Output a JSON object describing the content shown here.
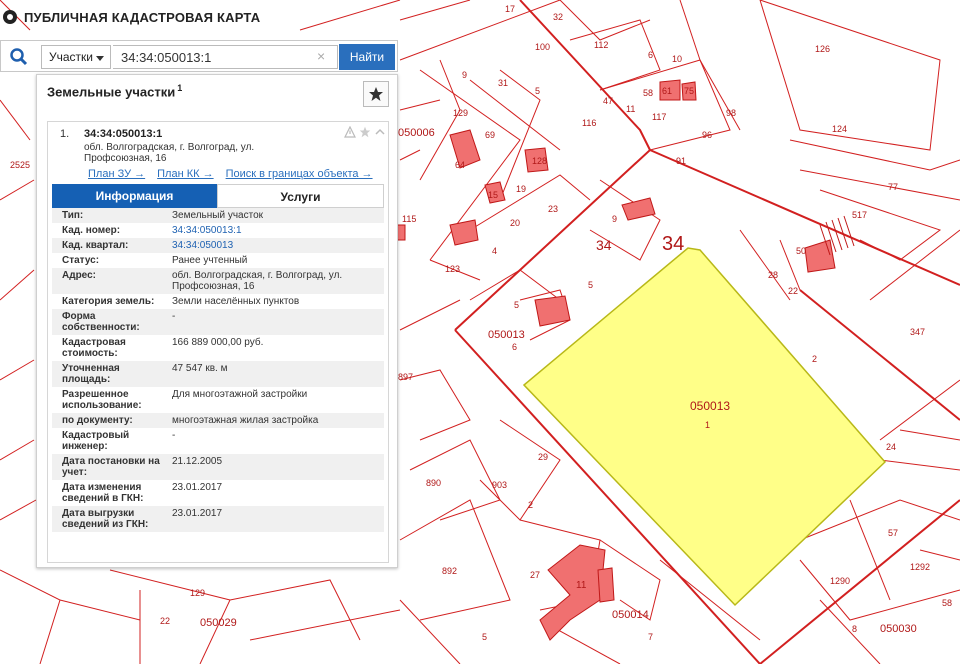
{
  "header": {
    "title": "ПУБЛИЧНАЯ КАДАСТРОВАЯ КАРТА"
  },
  "search": {
    "type_label": "Участки",
    "value": "34:34:050013:1",
    "button_label": "Найти"
  },
  "panel": {
    "title": "Земельные участки",
    "count": "1",
    "result": {
      "num": "1.",
      "id": "34:34:050013:1",
      "address": "обл. Волгоградская, г. Волгоград, ул. Профсоюзная, 16",
      "links": [
        "План ЗУ →",
        "План КК →",
        "Поиск в границах объекта →"
      ]
    },
    "tabs": {
      "info": "Информация",
      "services": "Услуги"
    },
    "rows": [
      {
        "key": "Тип:",
        "value": "Земельный участок"
      },
      {
        "key": "Кад. номер:",
        "value": "34:34:050013:1"
      },
      {
        "key": "Кад. квартал:",
        "value": "34:34:050013"
      },
      {
        "key": "Статус:",
        "value": "Ранее учтенный"
      },
      {
        "key": "Адрес:",
        "value": "обл. Волгоградская, г. Волгоград, ул. Профсоюзная, 16"
      },
      {
        "key": "Категория земель:",
        "value": "Земли населённых пунктов"
      },
      {
        "key": "Форма собственности:",
        "value": "-"
      },
      {
        "key": "Кадастровая стоимость:",
        "value": "166 889 000,00 руб."
      },
      {
        "key": "Уточненная площадь:",
        "value": "47 547 кв. м"
      },
      {
        "key": "Разрешенное использование:",
        "value": "Для многоэтажной застройки"
      },
      {
        "key": "по документу:",
        "value": "многоэтажная жилая застройка"
      },
      {
        "key": "Кадастровый инженер:",
        "value": "-"
      },
      {
        "key": "Дата постановки на учет:",
        "value": "21.12.2005"
      },
      {
        "key": "Дата изменения сведений в ГКН:",
        "value": "23.01.2017"
      },
      {
        "key": "Дата выгрузки сведений из ГКН:",
        "value": "23.01.2017"
      }
    ]
  },
  "map": {
    "colors": {
      "boundary": "#d22020",
      "building": "#f07070",
      "selected_fill": "#ffff88",
      "selected_stroke": "#b8b818"
    },
    "labels": {
      "q050013": "050013",
      "p1": "1",
      "n34a": "34",
      "n34b": "34",
      "q050006": "050006",
      "q050013b": "050013",
      "q050014": "050014",
      "q050029": "050029",
      "q050030": "050030",
      "n2525": "2525",
      "n17": "17",
      "n32": "32",
      "n100": "100",
      "n112": "112",
      "n126": "126",
      "n124": "124",
      "n116": "116",
      "n47": "47",
      "n11": "11",
      "n117": "117",
      "n58": "58",
      "n61": "61",
      "n75": "75",
      "n98": "98",
      "n96": "96",
      "n91": "91",
      "n77": "77",
      "n517": "517",
      "n50": "50",
      "n28": "28",
      "n22": "22",
      "n347": "347",
      "n9": "9",
      "n31": "31",
      "n5a": "5",
      "n129": "129",
      "n69": "69",
      "n64": "64",
      "n128": "128",
      "n15": "15",
      "n19": "19",
      "n23": "23",
      "n20": "20",
      "n4": "4",
      "n123": "123",
      "n897": "897",
      "n890": "890",
      "n903": "903",
      "n892": "892",
      "n1290": "1290",
      "n1292": "1292",
      "n57": "57",
      "n58b": "58",
      "n8": "8",
      "n24": "24",
      "n5b": "5",
      "n6": "6",
      "n5c": "5",
      "n29": "29",
      "n2": "2",
      "n27": "27",
      "n7": "7",
      "n129b": "129",
      "n22b": "22",
      "n5d": "5",
      "n115": "115",
      "n2b": "2",
      "n11b": "11",
      "n9b": "9",
      "n6b": "6",
      "n10": "10"
    }
  }
}
